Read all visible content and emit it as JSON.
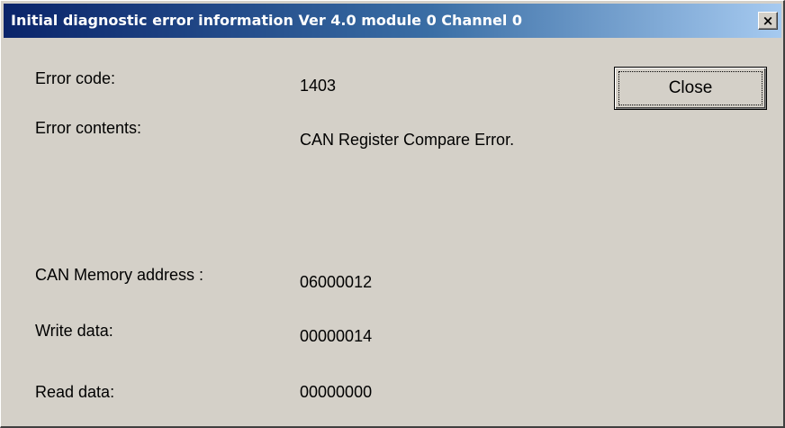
{
  "window": {
    "title": "Initial diagnostic error information Ver 4.0 module 0 Channel 0",
    "close_glyph": "×"
  },
  "fields": {
    "error_code": {
      "label": "Error code:",
      "value": "1403"
    },
    "error_contents": {
      "label": "Error contents:",
      "value": "CAN Register Compare Error."
    },
    "memory_address": {
      "label": "CAN Memory address :",
      "value": "06000012"
    },
    "write_data": {
      "label": "Write data:",
      "value": "00000014"
    },
    "read_data": {
      "label": "Read data:",
      "value": "00000000"
    }
  },
  "buttons": {
    "close_label": "Close"
  },
  "colors": {
    "title_bar_start": "#0a246a",
    "title_bar_end": "#a6caf0",
    "dialog_bg": "#d4d0c8"
  }
}
